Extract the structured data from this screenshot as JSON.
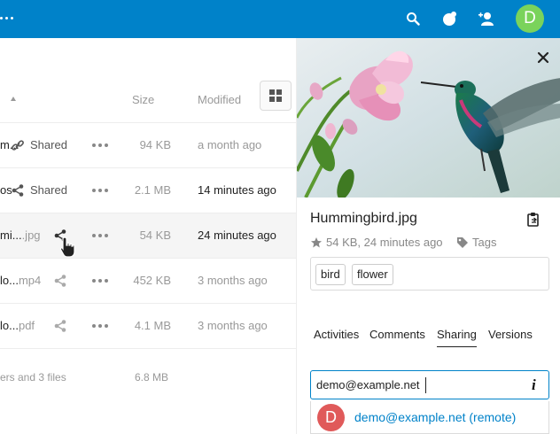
{
  "header": {
    "avatar_letter": "D",
    "icons": [
      "menu-dots-icon",
      "search-icon",
      "activity-icon",
      "contacts-icon"
    ],
    "brand_color": "#0082c9"
  },
  "filelist": {
    "columns": {
      "size": "Size",
      "modified": "Modified"
    },
    "rows": [
      {
        "name": "m...",
        "ext": "",
        "shared_label": "Shared",
        "size": "94 KB",
        "modified": "a month ago"
      },
      {
        "name": "os",
        "ext": "",
        "shared_label": "Shared",
        "size": "2.1 MB",
        "modified": "14 minutes ago"
      },
      {
        "name": "mi...",
        "ext": ".jpg",
        "shared_label": "",
        "size": "54 KB",
        "modified": "24 minutes ago"
      },
      {
        "name": "lo...",
        "ext": "mp4",
        "shared_label": "",
        "size": "452 KB",
        "modified": "3 months ago"
      },
      {
        "name": "lo...",
        "ext": "pdf",
        "shared_label": "",
        "size": "4.1 MB",
        "modified": "3 months ago"
      }
    ],
    "summary": "ers and 3 files",
    "summary_size": "6.8 MB"
  },
  "sidebar": {
    "filename": "Hummingbird.jpg",
    "meta": "54 KB, 24 minutes ago",
    "tags_label": "Tags",
    "tags": [
      "bird",
      "flower"
    ],
    "tabs": [
      "Activities",
      "Comments",
      "Sharing",
      "Versions"
    ],
    "active_tab": "Sharing",
    "share_input_value": "demo@example.net",
    "suggestion": {
      "avatar_letter": "D",
      "text": "demo@example.net (remote)"
    }
  }
}
